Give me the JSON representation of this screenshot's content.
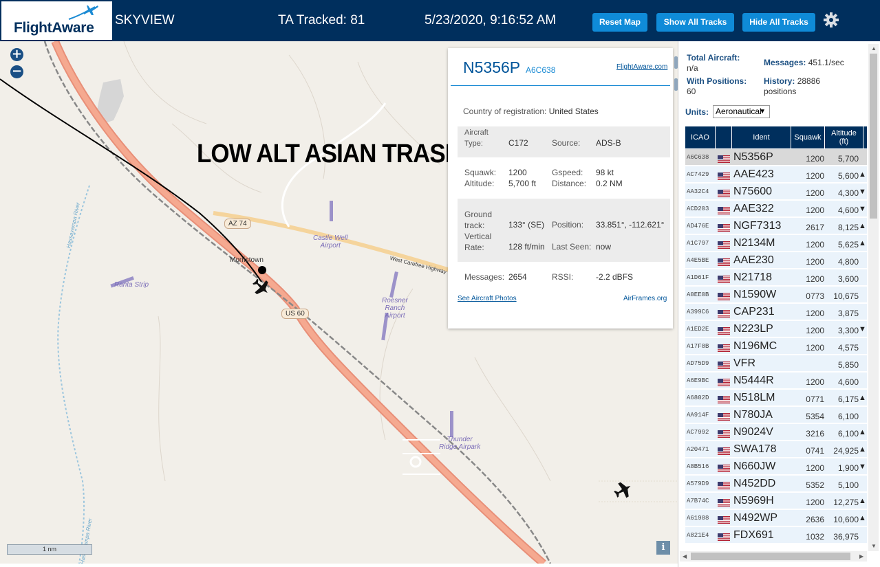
{
  "header": {
    "logo_text": "FlightAware",
    "site_name": "SKYVIEW",
    "tracked": "TA Tracked: 81",
    "datetime": "5/23/2020, 9:16:52 AM",
    "buttons": {
      "reset": "Reset Map",
      "show": "Show All Tracks",
      "hide": "Hide All Tracks"
    },
    "colors": {
      "bar": "#002f5d",
      "button": "#0f8bd8"
    }
  },
  "map": {
    "zoom_in": "+",
    "zoom_out": "−",
    "overlay_text": "LOW ALT ASIAN TRASH",
    "labels": {
      "morristown": "Morristown",
      "castle_well_1": "Castle Well",
      "castle_well_2": "Airport",
      "ranta": "Ranta Strip",
      "roesner_1": "Roesner",
      "roesner_2": "Ranch",
      "roesner_3": "Airport",
      "thunder_1": "Thunder",
      "thunder_2": "Ridge Airpark",
      "west_carefree": "West Carefree Highway",
      "hassayampa_1": "Hassayampa River",
      "hassayampa_2": "Hassayampa River"
    },
    "shields": {
      "az74": "AZ 74",
      "us60": "US 60"
    },
    "scale": "1 nm",
    "info": "i"
  },
  "popup": {
    "ident": "N5356P",
    "icao": "A6C638",
    "fa_link": "FlightAware.com",
    "country_label": "Country of registration:",
    "country_value": "United States",
    "aircraft_type_label_1": "Aircraft",
    "aircraft_type_label_2": "Type:",
    "aircraft_type": "C172",
    "source_label": "Source:",
    "source": "ADS-B",
    "squawk_label": "Squawk:",
    "squawk": "1200",
    "gspeed_label": "Gspeed:",
    "gspeed": "98 kt",
    "altitude_label": "Altitude:",
    "altitude": "5,700 ft",
    "distance_label": "Distance:",
    "distance": "0.2 NM",
    "track_label_1": "Ground",
    "track_label_2": "track:",
    "track": "133° (SE)",
    "position_label": "Position:",
    "position": "33.851°, -112.621°",
    "vrate_label_1": "Vertical",
    "vrate_label_2": "Rate:",
    "vrate": "128 ft/min",
    "lastseen_label": "Last Seen:",
    "lastseen": "now",
    "messages_label": "Messages:",
    "messages": "2654",
    "rssi_label": "RSSI:",
    "rssi": "-2.2 dBFS",
    "photos_link": "See Aircraft Photos",
    "airframes_link": "AirFrames.org"
  },
  "panel": {
    "total_aircraft_label": "Total Aircraft:",
    "total_aircraft_value": "n/a",
    "messages_label": "Messages:",
    "messages_value": "451.1/sec",
    "with_positions_label": "With Positions:",
    "with_positions_value": "60",
    "history_label": "History:",
    "history_value": "28886",
    "history_unit": "positions",
    "units_label": "Units:",
    "units_value": "Aeronautical",
    "columns": {
      "icao": "ICAO",
      "ident": "Ident",
      "squawk": "Squawk",
      "alt_1": "Altitude",
      "alt_2": "(ft)"
    },
    "rows": [
      {
        "icao": "A6C638",
        "ident": "N5356P",
        "squawk": "1200",
        "alt": "5,700",
        "trend": ""
      },
      {
        "icao": "AC7429",
        "ident": "AAE423",
        "squawk": "1200",
        "alt": "5,600",
        "trend": "▲"
      },
      {
        "icao": "AA32C4",
        "ident": "N75600",
        "squawk": "1200",
        "alt": "4,300",
        "trend": "▼"
      },
      {
        "icao": "ACD203",
        "ident": "AAE322",
        "squawk": "1200",
        "alt": "4,600",
        "trend": "▼"
      },
      {
        "icao": "AD476E",
        "ident": "NGF7313",
        "squawk": "2617",
        "alt": "8,125",
        "trend": "▲"
      },
      {
        "icao": "A1C797",
        "ident": "N2134M",
        "squawk": "1200",
        "alt": "5,625",
        "trend": "▲"
      },
      {
        "icao": "A4E5BE",
        "ident": "AAE230",
        "squawk": "1200",
        "alt": "4,800",
        "trend": ""
      },
      {
        "icao": "A1D61F",
        "ident": "N21718",
        "squawk": "1200",
        "alt": "3,600",
        "trend": ""
      },
      {
        "icao": "A0EE0B",
        "ident": "N1590W",
        "squawk": "0773",
        "alt": "10,675",
        "trend": ""
      },
      {
        "icao": "A399C6",
        "ident": "CAP231",
        "squawk": "1200",
        "alt": "3,875",
        "trend": ""
      },
      {
        "icao": "A1ED2E",
        "ident": "N223LP",
        "squawk": "1200",
        "alt": "3,300",
        "trend": "▼"
      },
      {
        "icao": "A17F8B",
        "ident": "N196MC",
        "squawk": "1200",
        "alt": "4,575",
        "trend": ""
      },
      {
        "icao": "AD75D9",
        "ident": "VFR",
        "squawk": "",
        "alt": "5,850",
        "trend": ""
      },
      {
        "icao": "A6E9BC",
        "ident": "N5444R",
        "squawk": "1200",
        "alt": "4,600",
        "trend": ""
      },
      {
        "icao": "A6802D",
        "ident": "N518LM",
        "squawk": "0771",
        "alt": "6,175",
        "trend": "▲"
      },
      {
        "icao": "AA914F",
        "ident": "N780JA",
        "squawk": "5354",
        "alt": "6,100",
        "trend": ""
      },
      {
        "icao": "AC7992",
        "ident": "N9024V",
        "squawk": "3216",
        "alt": "6,100",
        "trend": "▲"
      },
      {
        "icao": "A20471",
        "ident": "SWA178",
        "squawk": "0741",
        "alt": "24,925",
        "trend": "▲"
      },
      {
        "icao": "A8B516",
        "ident": "N660JW",
        "squawk": "1200",
        "alt": "1,900",
        "trend": "▼"
      },
      {
        "icao": "A579D9",
        "ident": "N452DD",
        "squawk": "5352",
        "alt": "5,100",
        "trend": ""
      },
      {
        "icao": "A7B74C",
        "ident": "N5969H",
        "squawk": "1200",
        "alt": "12,275",
        "trend": "▲"
      },
      {
        "icao": "A61988",
        "ident": "N492WP",
        "squawk": "2636",
        "alt": "10,600",
        "trend": "▲"
      },
      {
        "icao": "A821E4",
        "ident": "FDX691",
        "squawk": "1032",
        "alt": "36,975",
        "trend": ""
      }
    ]
  }
}
